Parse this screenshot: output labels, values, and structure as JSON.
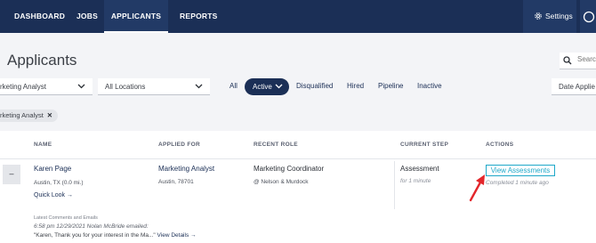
{
  "nav": {
    "items": [
      {
        "label": "DASHBOARD"
      },
      {
        "label": "JOBS"
      },
      {
        "label": "APPLICANTS"
      },
      {
        "label": "REPORTS"
      }
    ],
    "settings_label": "Settings"
  },
  "page": {
    "title": "Applicants"
  },
  "search": {
    "placeholder": "Search"
  },
  "filters": {
    "job_title": "rketing Analyst",
    "location": "All Locations",
    "tabs": [
      "All",
      "Active",
      "Disqualified",
      "Hired",
      "Pipeline",
      "Inactive"
    ],
    "active_tab": "Active",
    "date_sort": "Date Applie"
  },
  "chip": {
    "label": "rketing Analyst",
    "remove": "✕"
  },
  "table": {
    "headers": {
      "name": "NAME",
      "applied_for": "APPLIED FOR",
      "recent_role": "RECENT ROLE",
      "current_step": "CURRENT STEP",
      "actions": "ACTIONS"
    },
    "row": {
      "expander": "–",
      "name": "Karen Page",
      "location": "Austin, TX (0.0 mi.)",
      "quick_look": "Quick Look →",
      "applied_job": "Marketing Analyst",
      "applied_location": "Austin, 78701",
      "recent_role": "Marketing Coordinator",
      "recent_company": "@ Nelson & Murdock",
      "current_step": "Assessment",
      "step_duration": "for 1 minute",
      "action_button": "View Assessments",
      "action_status": "Completed 1 minute ago"
    },
    "comments": {
      "header": "Latest Comments and Emails",
      "meta": "6:58 pm 12/29/2021 Nolan McBride emailed:",
      "excerpt": "\"Karen, Thank you for your interest in the Ma...\"",
      "view_details": "View Details →"
    }
  },
  "colors": {
    "nav_bg": "#1b2f56",
    "accent": "#1fa8c9",
    "annotation_arrow": "#e3262b"
  }
}
